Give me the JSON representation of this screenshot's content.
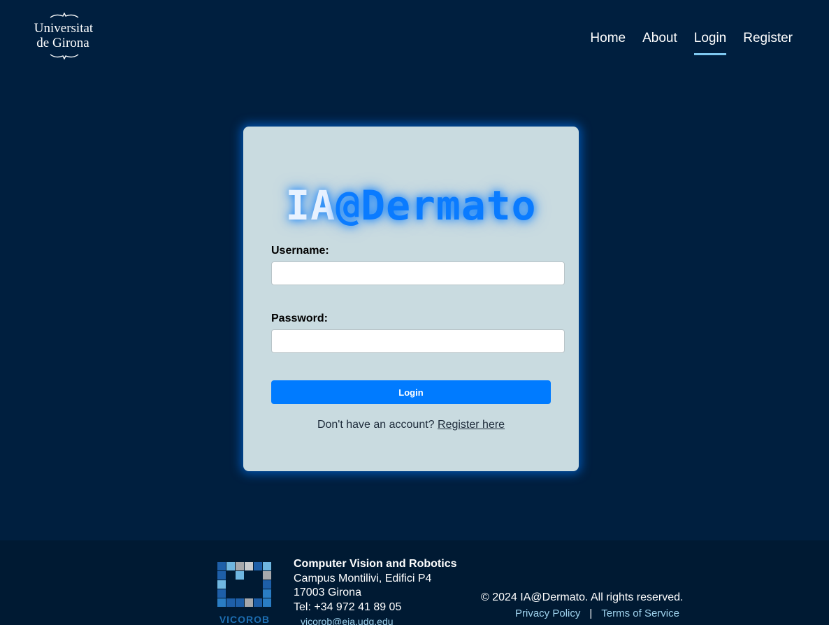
{
  "header": {
    "logo": {
      "line1": "Universitat",
      "line2": "de Girona"
    },
    "nav": [
      {
        "label": "Home"
      },
      {
        "label": "About"
      },
      {
        "label": "Login",
        "active": true
      },
      {
        "label": "Register"
      }
    ]
  },
  "login": {
    "brand_part1": "IA",
    "brand_part2": "@Dermato",
    "username_label": "Username:",
    "username_value": "",
    "password_label": "Password:",
    "password_value": "",
    "button_label": "Login",
    "register_prompt": "Don't have an account?",
    "register_link": "Register here"
  },
  "footer": {
    "logo_text": "VICOROB",
    "org_name": "Computer Vision and Robotics",
    "address1": "Campus Montilivi, Edifici P4",
    "address2": "17003 Girona",
    "phone": "Tel: +34 972 41 89 05",
    "email": "vicorob@eia.udg.edu",
    "copyright": "© 2024 IA@Dermato. All rights reserved.",
    "privacy": "Privacy Policy",
    "separator": "|",
    "terms": "Terms of Service"
  },
  "colors": {
    "background": "#001f3f",
    "card": "#c9dbe0",
    "accent": "#007bff",
    "footer": "#001a33"
  }
}
